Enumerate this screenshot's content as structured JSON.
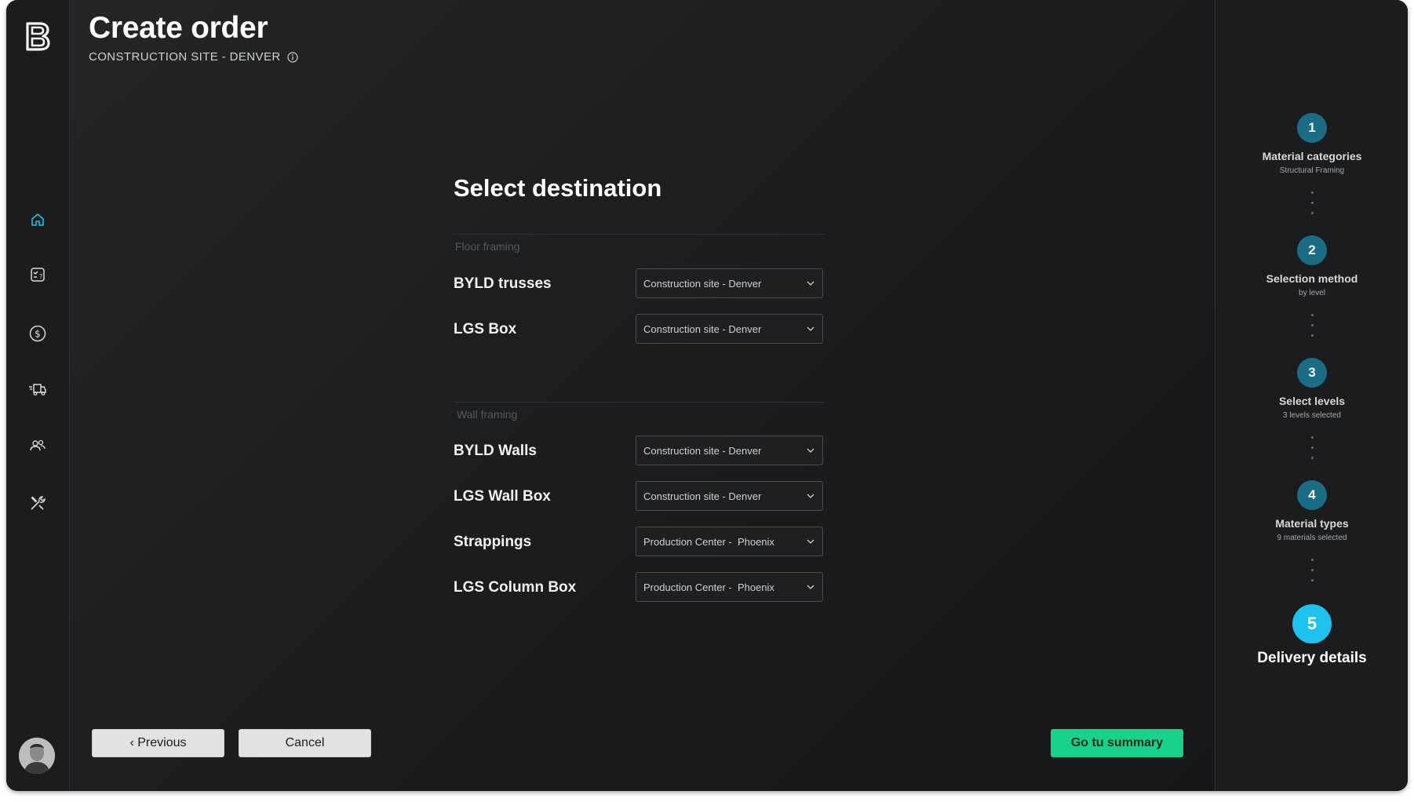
{
  "header": {
    "title": "Create order",
    "subtitle": "CONSTRUCTION SITE - DENVER"
  },
  "sidebar": {
    "logo": "B",
    "items": [
      {
        "icon": "home-icon",
        "active": true
      },
      {
        "icon": "checklist-icon",
        "active": false
      },
      {
        "icon": "dollar-icon",
        "active": false
      },
      {
        "icon": "delivery-truck-icon",
        "active": false
      },
      {
        "icon": "users-icon",
        "active": false
      },
      {
        "icon": "tools-icon",
        "active": false
      }
    ]
  },
  "form": {
    "title": "Select destination",
    "sections": [
      {
        "label": "Floor framing",
        "rows": [
          {
            "label": "BYLD trusses",
            "value": "Construction site - Denver"
          },
          {
            "label": "LGS Box",
            "value": "Construction site - Denver"
          }
        ]
      },
      {
        "label": "Wall framing",
        "rows": [
          {
            "label": "BYLD Walls",
            "value": "Construction site - Denver"
          },
          {
            "label": "LGS Wall Box",
            "value": "Construction site - Denver"
          },
          {
            "label": "Strappings",
            "value": "Production Center -  Phoenix"
          },
          {
            "label": "LGS Column Box",
            "value": "Production Center -  Phoenix"
          }
        ]
      }
    ]
  },
  "buttons": {
    "previous": "‹ Previous",
    "cancel": "Cancel",
    "summary": "Go tu summary"
  },
  "steps": [
    {
      "number": "1",
      "title": "Material categories",
      "subtitle": "Structural Framing"
    },
    {
      "number": "2",
      "title": "Selection method",
      "subtitle": "by level"
    },
    {
      "number": "3",
      "title": "Select levels",
      "subtitle": "3 levels selected"
    },
    {
      "number": "4",
      "title": "Material types",
      "subtitle": "9 materials selected"
    },
    {
      "number": "5",
      "title": "Delivery details",
      "subtitle": ""
    }
  ],
  "colors": {
    "accent": "#1ec2ef",
    "step": "#1b6c85",
    "primary_button": "#16d28a",
    "background": "#1a1b1d"
  }
}
